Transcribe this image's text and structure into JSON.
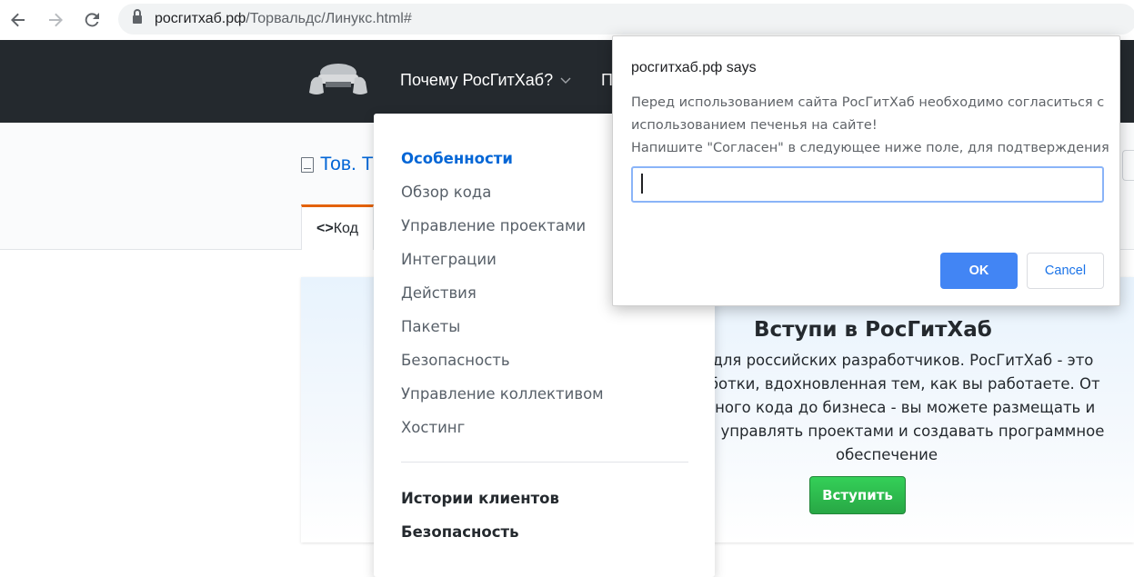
{
  "browser": {
    "url_host": "росгитхаб.рф",
    "url_path": "/Торвальдс/Линукс.html#",
    "icons": {
      "back": "arrow-left-icon",
      "forward": "arrow-right-icon",
      "reload": "reload-icon",
      "lock": "lock-icon"
    }
  },
  "header": {
    "nav_why": "Почему РосГитХаб?",
    "nav_cut": "П"
  },
  "repo": {
    "title": "Тов. Т",
    "code_tab": "Код",
    "code_icon": "<>"
  },
  "dropdown": {
    "items": [
      {
        "label": "Особенности"
      },
      {
        "label": "Обзор кода"
      },
      {
        "label": "Управление проектами"
      },
      {
        "label": "Интеграции"
      },
      {
        "label": "Действия"
      },
      {
        "label": "Пакеты"
      },
      {
        "label": "Безопасность"
      },
      {
        "label": "Управление коллективом"
      },
      {
        "label": "Хостинг"
      }
    ],
    "bottom_items": [
      {
        "label": "Истории клиентов"
      },
      {
        "label": "Безопасность"
      }
    ]
  },
  "join": {
    "title": "Вступи в РосГитХаб",
    "lines": [
      "ван для российских разработчиков. РосГитХаб - это",
      "азработки, вдохновленная тем, как вы работаете. От",
      "сходного кода до бизнеса - вы можете размещать и",
      "ь код, управлять проектами и создавать программное",
      "обеспечение"
    ],
    "button": "Вступить"
  },
  "dialog": {
    "title": "росгитхаб.рф says",
    "message_lines": [
      "Перед использованием сайта РосГитХаб необходимо согласиться с",
      "использованием печенья на сайте!",
      "Напишите \"Согласен\" в следующее ниже поле, для подтверждения"
    ],
    "input_value": "",
    "ok": "OK",
    "cancel": "Cancel"
  },
  "colors": {
    "header_bg": "#24292e",
    "link_blue": "#0366d6",
    "ok_blue": "#4285f4",
    "join_green": "#28a745",
    "tab_accent": "#e36209"
  }
}
